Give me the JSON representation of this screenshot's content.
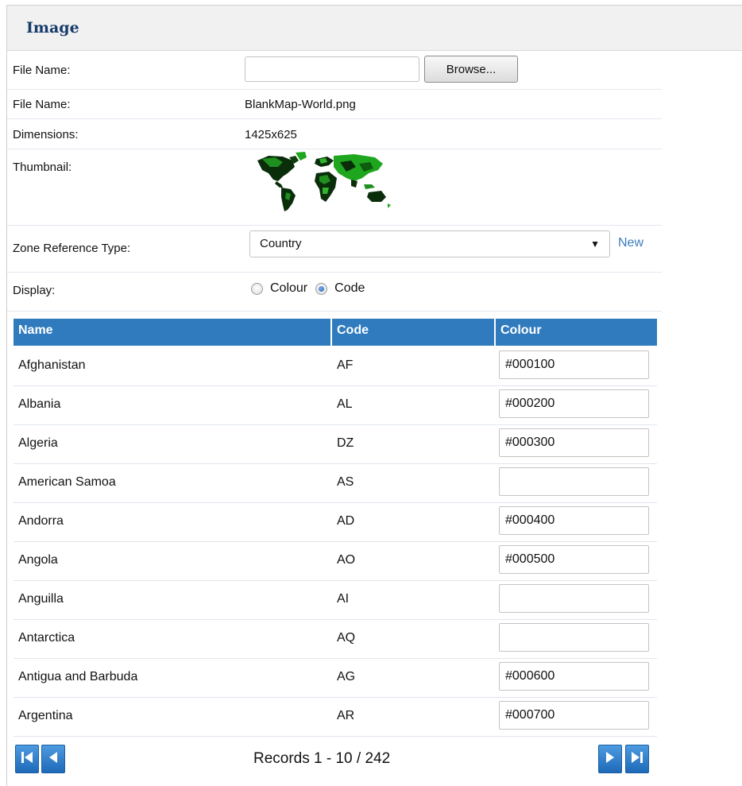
{
  "panel": {
    "title": "Image"
  },
  "form": {
    "file_upload": {
      "label": "File Name:",
      "value": "",
      "browse_label": "Browse..."
    },
    "file_name": {
      "label": "File Name:",
      "value": "BlankMap-World.png"
    },
    "dimensions": {
      "label": "Dimensions:",
      "value": "1425x625"
    },
    "thumbnail": {
      "label": "Thumbnail:",
      "icon": "world-map-thumbnail"
    },
    "zone_reference_type": {
      "label": "Zone Reference Type:",
      "selected": "Country",
      "new_link": "New"
    },
    "display": {
      "label": "Display:",
      "options": [
        {
          "label": "Colour",
          "checked": false
        },
        {
          "label": "Code",
          "checked": true
        }
      ]
    }
  },
  "grid": {
    "columns": [
      "Name",
      "Code",
      "Colour"
    ],
    "rows": [
      {
        "name": "Afghanistan",
        "code": "AF",
        "colour": "#000100"
      },
      {
        "name": "Albania",
        "code": "AL",
        "colour": "#000200"
      },
      {
        "name": "Algeria",
        "code": "DZ",
        "colour": "#000300"
      },
      {
        "name": "American Samoa",
        "code": "AS",
        "colour": ""
      },
      {
        "name": "Andorra",
        "code": "AD",
        "colour": "#000400"
      },
      {
        "name": "Angola",
        "code": "AO",
        "colour": "#000500"
      },
      {
        "name": "Anguilla",
        "code": "AI",
        "colour": ""
      },
      {
        "name": "Antarctica",
        "code": "AQ",
        "colour": ""
      },
      {
        "name": "Antigua and Barbuda",
        "code": "AG",
        "colour": "#000600"
      },
      {
        "name": "Argentina",
        "code": "AR",
        "colour": "#000700"
      }
    ]
  },
  "pager": {
    "text": "Records 1 - 10 / 242",
    "first_icon": "first-page-icon",
    "prev_icon": "previous-page-icon",
    "next_icon": "next-page-icon",
    "last_icon": "last-page-icon"
  },
  "colors": {
    "header_blue": "#2f7bbe",
    "link_blue": "#3a7bbd",
    "title_navy": "#173b6b"
  }
}
